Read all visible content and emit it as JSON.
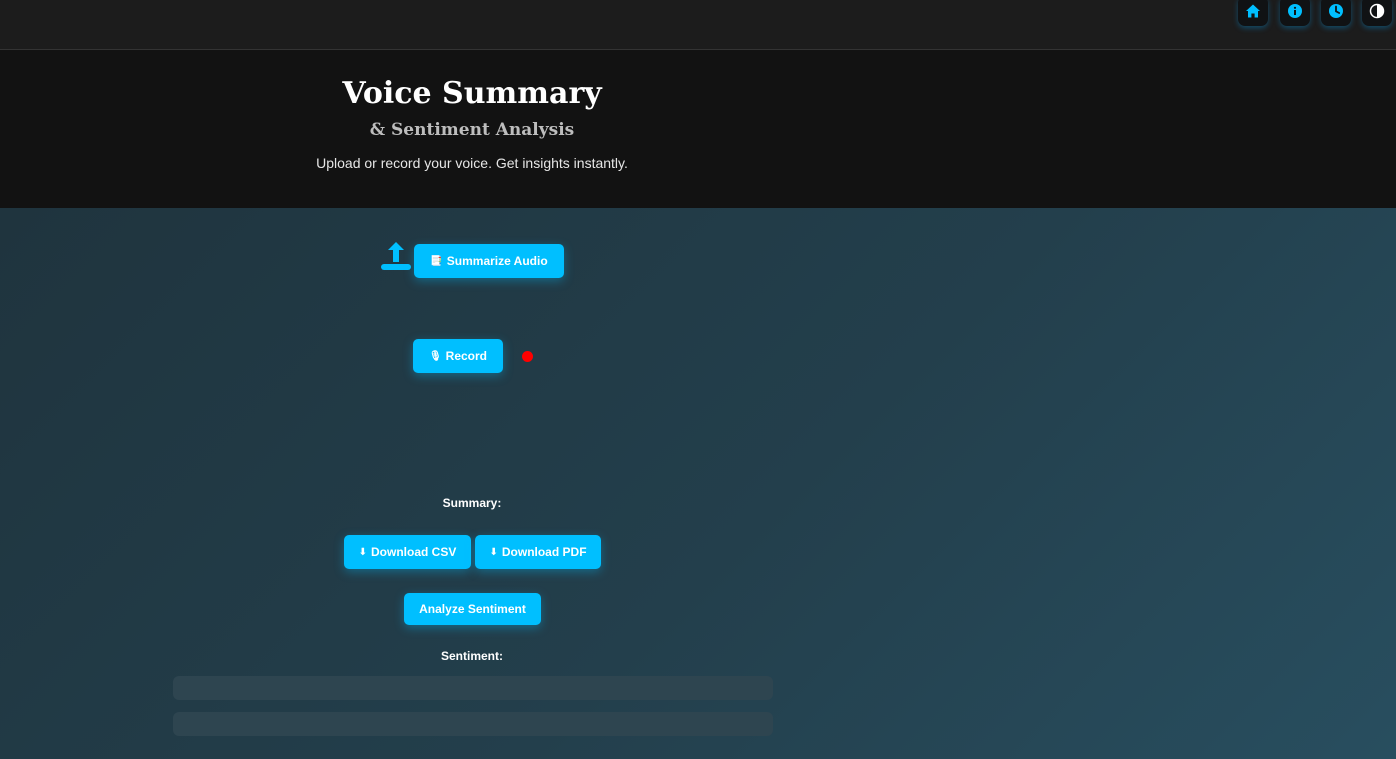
{
  "nav": {
    "icons": [
      "home-icon",
      "info-icon",
      "history-icon",
      "theme-toggle-icon"
    ],
    "accent": "#00bfff"
  },
  "hero": {
    "title": "Voice Summary",
    "subtitle": "& Sentiment Analysis",
    "tagline": "Upload or record your voice. Get insights instantly."
  },
  "actions": {
    "summarize_icon": "📑",
    "summarize_label": "Summarize Audio",
    "record_icon": "🎙",
    "record_label": "Record",
    "download_icon": "⬇",
    "download_csv_label": "Download CSV",
    "download_pdf_label": "Download PDF",
    "analyze_label": "Analyze Sentiment"
  },
  "results": {
    "summary_label": "Summary:",
    "sentiment_label": "Sentiment:"
  }
}
